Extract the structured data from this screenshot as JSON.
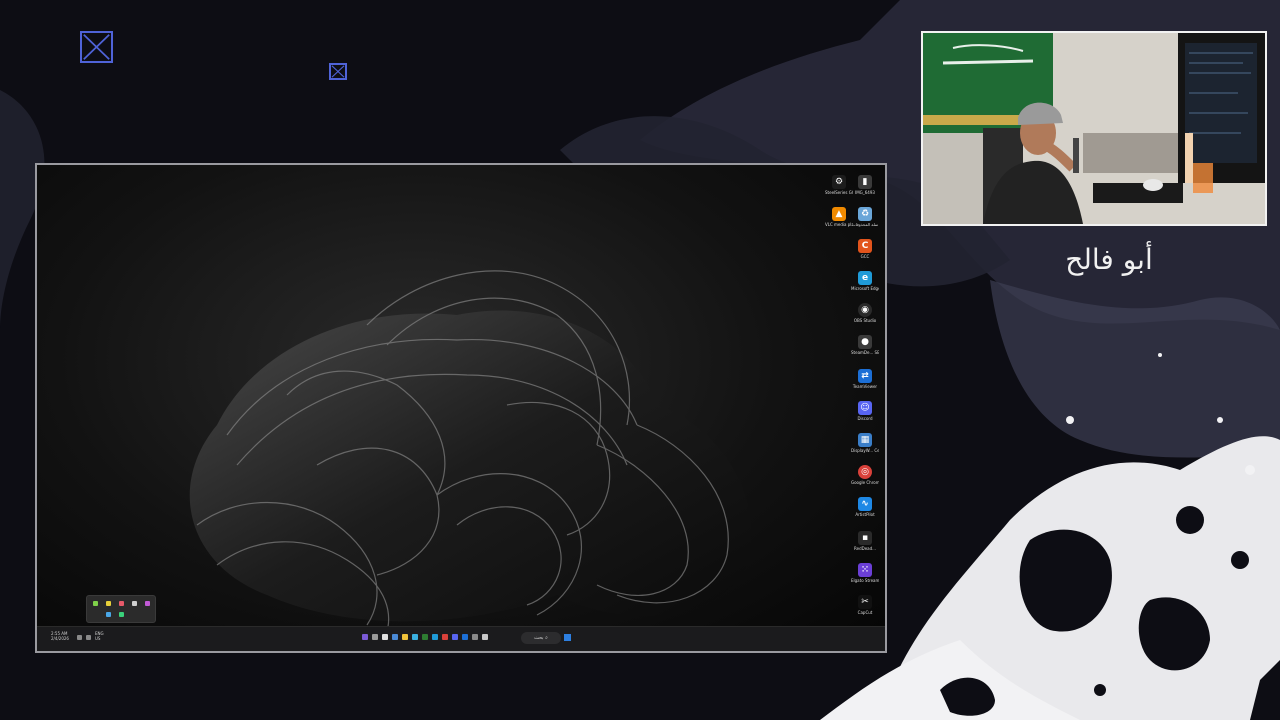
{
  "overlay": {
    "streamer_name": "أبو فالح",
    "accent_color": "#4f63d8",
    "background_color": "#0d0d14"
  },
  "desktop": {
    "icons": [
      {
        "label": "SteelSeries GG",
        "icon": "steelseries-icon",
        "color": "#1c1c1c"
      },
      {
        "label": "IMG_6493",
        "icon": "image-file-icon",
        "color": "#3a3a3a"
      },
      {
        "label": "VLC media player",
        "icon": "vlc-icon",
        "color": "#f08a00"
      },
      {
        "label": "سلة المحذوفات",
        "icon": "recycle-bin-icon",
        "color": "#6aa6d8"
      },
      {
        "label": "GCC",
        "icon": "gcc-icon",
        "color": "#e2541c"
      },
      {
        "label": "Microsoft Edge",
        "icon": "edge-icon",
        "color": "#1f9bd8"
      },
      {
        "label": "OBS Studio",
        "icon": "obs-icon",
        "color": "#2a2a2a"
      },
      {
        "label": "SteamDe... SE(64",
        "icon": "steamdeck-icon",
        "color": "#3a3a3a"
      },
      {
        "label": "TeamViewer",
        "icon": "teamviewer-icon",
        "color": "#1c6fd6"
      },
      {
        "label": "Discord",
        "icon": "discord-icon",
        "color": "#5865f2"
      },
      {
        "label": "DisplayW... Center",
        "icon": "display-center-icon",
        "color": "#3a7ec8"
      },
      {
        "label": "Google Chrome",
        "icon": "chrome-icon",
        "color": "#d9413a"
      },
      {
        "label": "ArtistPilot",
        "icon": "artist-icon",
        "color": "#1e88e5"
      },
      {
        "label": "RedDead... ",
        "icon": "game-shortcut-icon",
        "color": "#2a2a2a"
      },
      {
        "label": "Elgato Stream Deck",
        "icon": "stream-deck-icon",
        "color": "#6b3fd6"
      },
      {
        "label": "CapCut",
        "icon": "capcut-icon",
        "color": "#111111"
      }
    ],
    "taskbar": {
      "time": "2:55 AM",
      "date": "2/4/2026",
      "lang": "ENG US",
      "search_label": "بحث"
    }
  }
}
